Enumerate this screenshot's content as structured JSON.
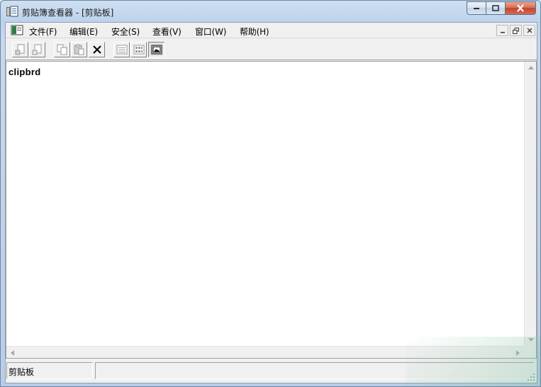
{
  "window": {
    "title": "剪贴簿查看器 - [剪贴板]",
    "icon": "clipbook-icon"
  },
  "menu": {
    "items": [
      {
        "label": "文件(F)"
      },
      {
        "label": "编辑(E)"
      },
      {
        "label": "安全(S)"
      },
      {
        "label": "查看(V)"
      },
      {
        "label": "窗口(W)"
      },
      {
        "label": "帮助(H)"
      }
    ]
  },
  "toolbar": {
    "buttons": [
      {
        "icon": "connect-icon"
      },
      {
        "icon": "disconnect-icon"
      },
      {
        "icon": "copy-icon"
      },
      {
        "icon": "paste-icon"
      },
      {
        "icon": "delete-icon"
      },
      {
        "icon": "table-of-contents-icon"
      },
      {
        "icon": "thumbnails-icon"
      },
      {
        "icon": "full-page-icon",
        "pressed": true
      }
    ]
  },
  "content": {
    "text": "clipbrd"
  },
  "statusbar": {
    "panel1": "剪贴板",
    "panel2": ""
  }
}
